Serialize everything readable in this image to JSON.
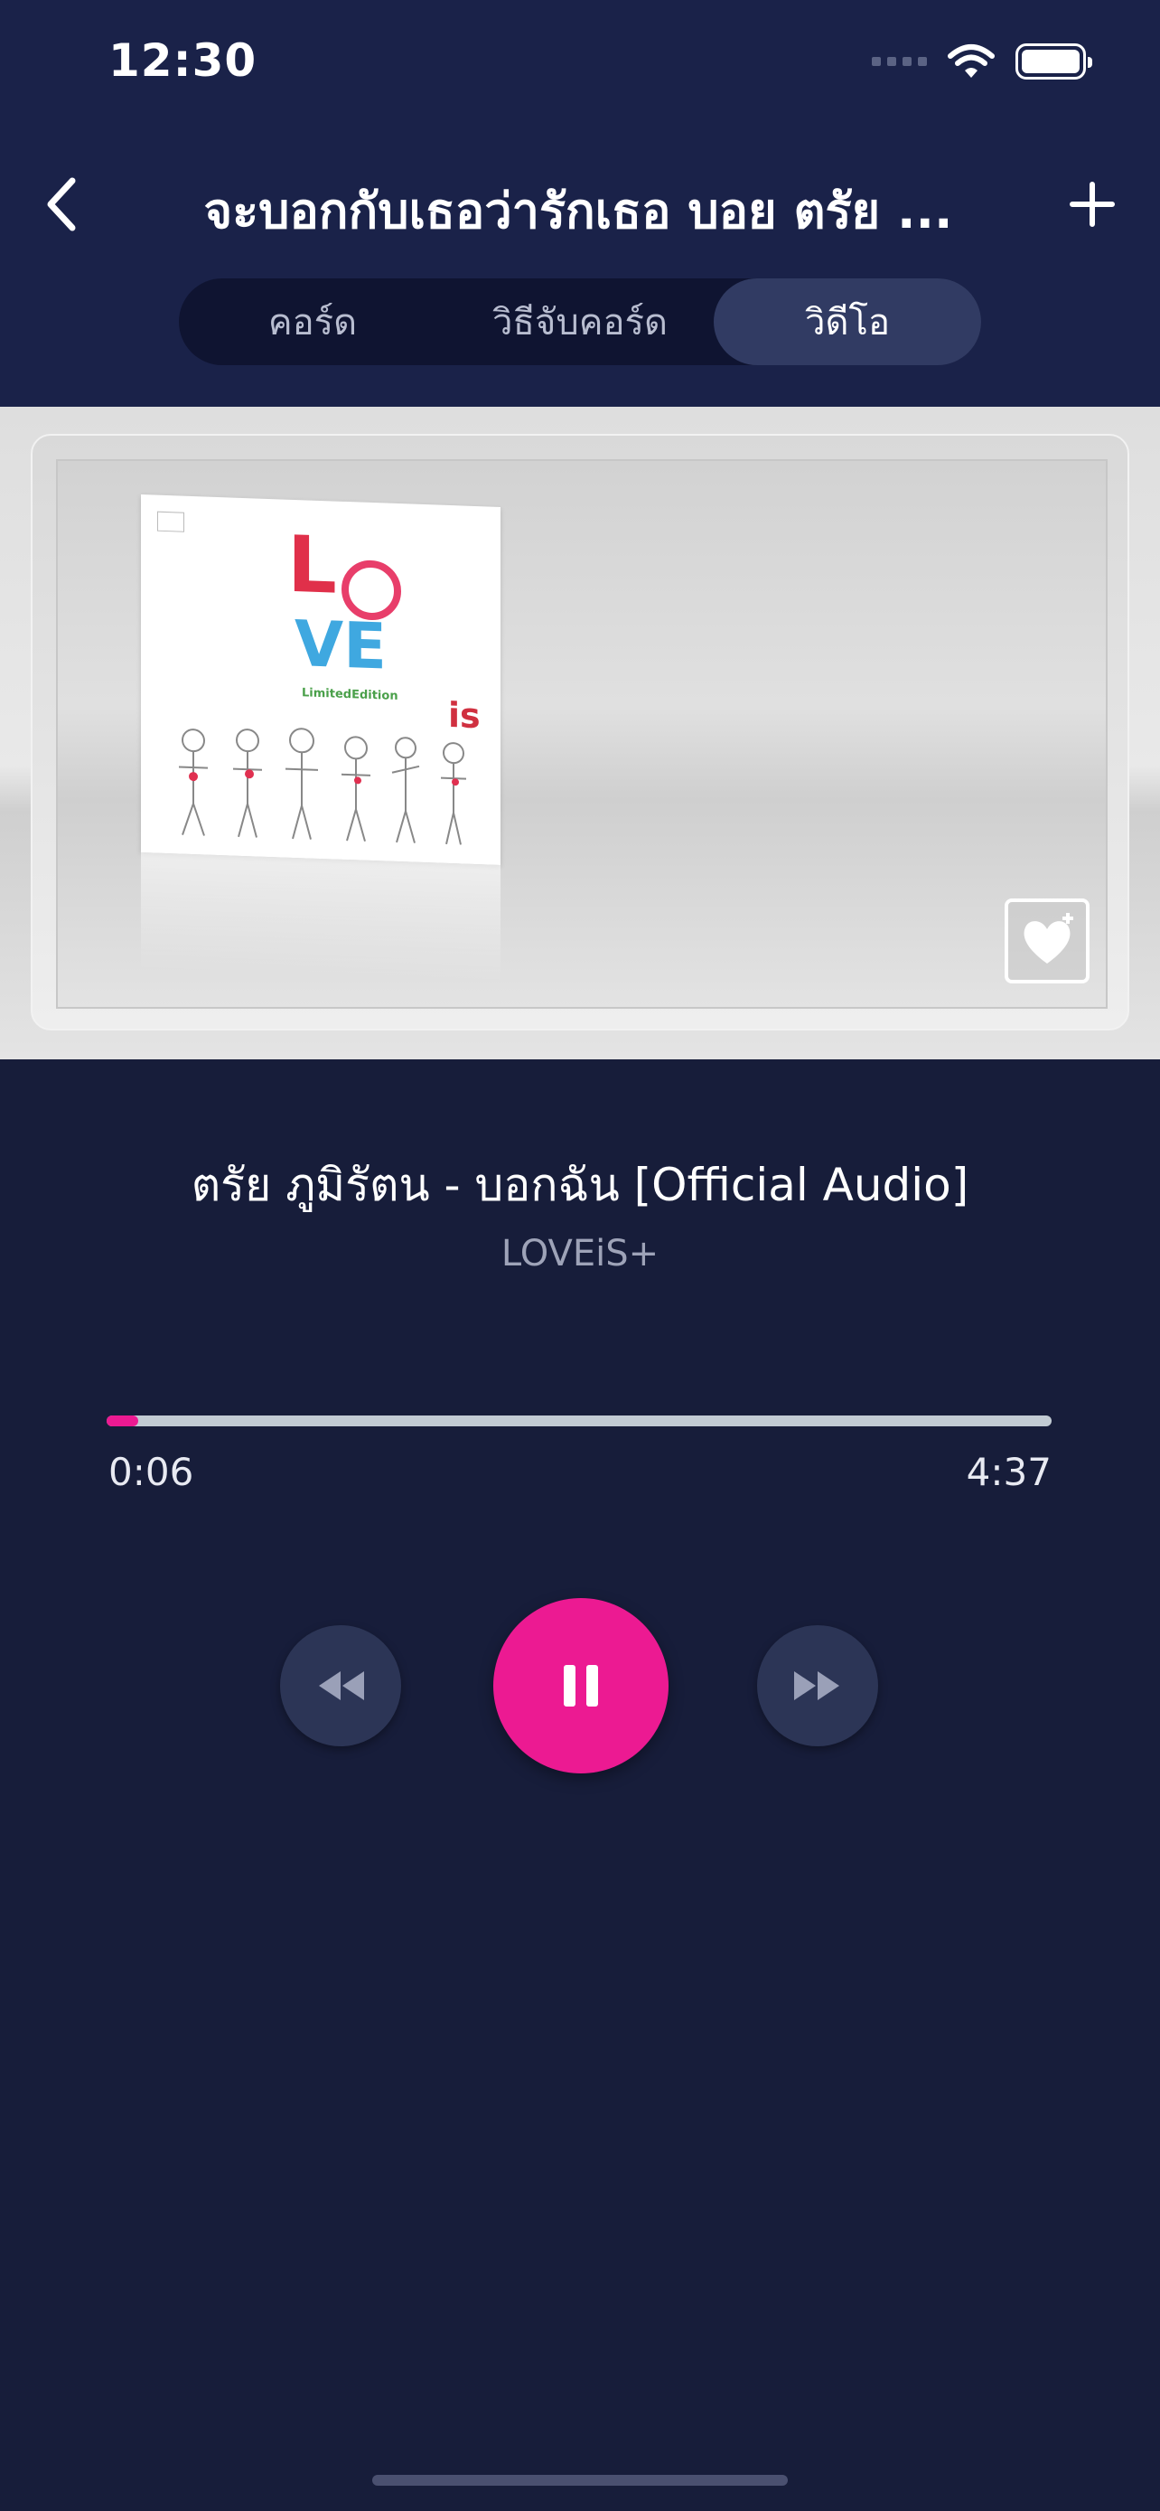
{
  "status_bar": {
    "time": "12:30",
    "icons": [
      "signal-icon",
      "wifi-icon",
      "battery-icon"
    ]
  },
  "nav": {
    "back_icon": "chevron-left-icon",
    "title": "จะบอกกับเธอว่ารักเธอ บอย ตรัย ...",
    "add_icon": "plus-icon"
  },
  "tabs": [
    {
      "label": "คอร์ด",
      "active": false
    },
    {
      "label": "วิธีจับคอร์ด",
      "active": false
    },
    {
      "label": "วิดีโอ",
      "active": true
    }
  ],
  "video": {
    "poster_text_love_l": "L",
    "poster_text_love_ve": "VE",
    "poster_text_edition": "LimitedEdition",
    "poster_text_is": "is",
    "watermark_icon": "loveis-logo-icon"
  },
  "track": {
    "title": "ตรัย ภูมิรัตน - บอกฉัน [Official Audio]",
    "artist": "LOVEiS+"
  },
  "progress": {
    "elapsed": "0:06",
    "total": "4:37",
    "fraction": 0.033
  },
  "controls": {
    "rewind_icon": "rewind-icon",
    "pause_icon": "pause-icon",
    "forward_icon": "fast-forward-icon"
  },
  "colors": {
    "background": "#171d3a",
    "header": "#1a2249",
    "accent": "#ec1a92",
    "tab_active": "#313b63"
  }
}
